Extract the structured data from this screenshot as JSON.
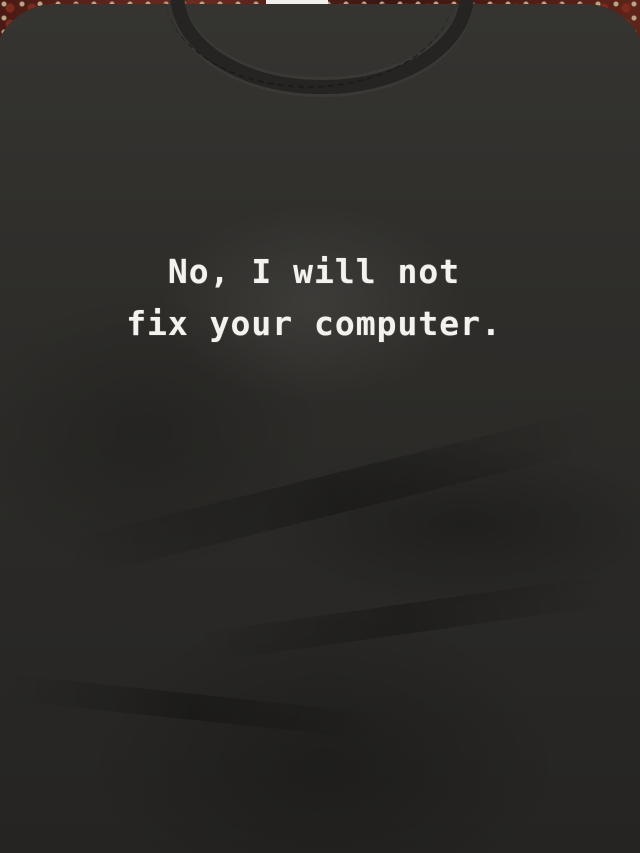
{
  "shirt_print": {
    "line1": "No, I will not",
    "line2": "fix your computer."
  },
  "colors": {
    "shirt": "#2e2d2a",
    "print_text": "#f3f2ee",
    "carpet": "#5e2419",
    "tag": "#f1efe9"
  }
}
